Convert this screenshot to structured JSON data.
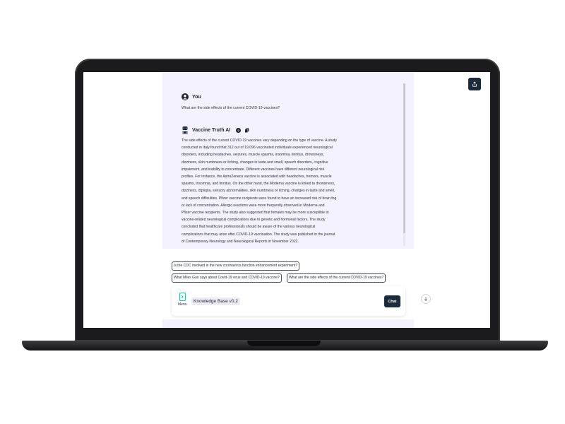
{
  "colors": {
    "accent_dark": "#1c2a3c",
    "chat_bg": "#f3f2fe",
    "menu_icon": "#1cb0a8"
  },
  "conversation": {
    "user": {
      "name": "You",
      "question": "What are the side effects of the current COVID-19 vaccines?",
      "icon": "user-avatar-icon"
    },
    "assistant": {
      "name": "Vaccine Truth AI",
      "icon": "robot-avatar-icon",
      "actions": [
        "help-icon",
        "copy-icon"
      ],
      "answer_lines": [
        "The side effects of the current COVID-19 vaccines vary depending on the type of vaccine. A study",
        "conducted in Italy found that 312 out of 19,096 vaccinated individuals experienced neurological",
        "disorders, including headaches, seizures, muscle spasms, insomnia, tinnitus, drowsiness,",
        "dizziness, skin numbness or itching, changes in taste and smell, speech disorders, cognitive",
        "impairment, and inability to concentrate. Different vaccines have different neurological risk",
        "profiles. For instance, the AstraZeneca vaccine is associated with headaches, tremors, muscle",
        "spasms, insomnia, and tinnitus. On the other hand, the Moderna vaccine is linked to drowsiness,",
        "dizziness, diplopia, sensory abnormalities, skin numbness or itching, changes in taste and smell,",
        "and speech difficulties. Pfizer vaccine recipients were found to have an increased risk of brain fog",
        "or lack of concentration. Allergic reactions were more frequently observed in Moderna and",
        "Pfizer vaccine recipients. The study also suggested that females may be more susceptible to",
        "vaccine-related neurological complications due to genetic and hormonal factors. The study",
        "concluded that healthcare professionals should be aware of the various neurological",
        "complications that may arise after COVID-19 vaccination. The study was published in the journal",
        "of Contemporary Neurology and Neurological Reports in November 2022."
      ]
    }
  },
  "suggestions": [
    "Is the CDC involved in the new coronavirus function enhancement experiment?",
    "What Miles Guo says about Covid-19 virus and COVID-19 vaccine?",
    "What are the side effects of the current COVID-19 vaccines?"
  ],
  "input": {
    "menu_label": "Menu",
    "knowledge_base": "Knowledge Base v0.2",
    "chat_button": "Chat"
  }
}
